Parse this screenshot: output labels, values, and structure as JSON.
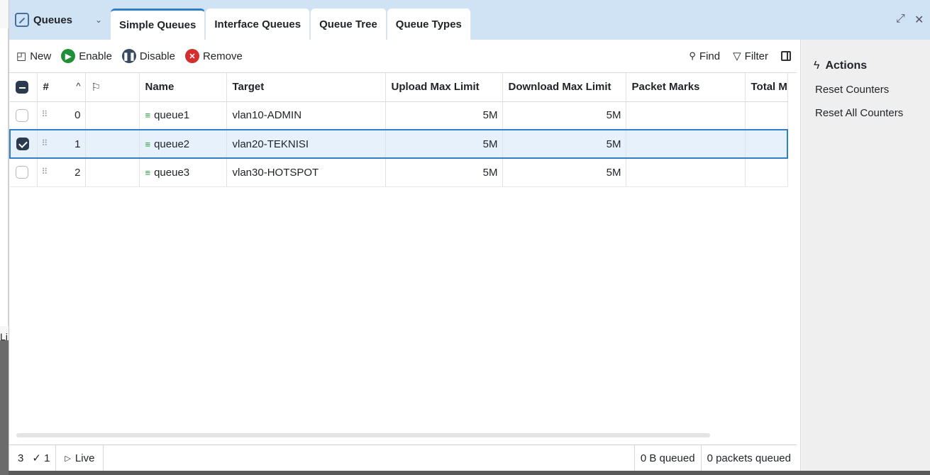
{
  "window": {
    "app_title": "Queues",
    "dropdown_glyph": "⌄",
    "tabs": [
      {
        "label": "Simple Queues",
        "active": true
      },
      {
        "label": "Interface Queues",
        "active": false
      },
      {
        "label": "Queue Tree",
        "active": false
      },
      {
        "label": "Queue Types",
        "active": false
      }
    ],
    "restore_glyph": "⤢",
    "close_glyph": "✕"
  },
  "toolbar": {
    "new_label": "New",
    "enable_label": "Enable",
    "disable_label": "Disable",
    "remove_label": "Remove",
    "find_label": "Find",
    "filter_label": "Filter"
  },
  "table": {
    "columns": [
      "",
      "#",
      "",
      "Name",
      "Target",
      "Upload Max Limit",
      "Download Max Limit",
      "Packet Marks",
      "Total M"
    ],
    "rows": [
      {
        "checked": false,
        "num": "0",
        "name": "queue1",
        "target": "vlan10-ADMIN",
        "upload": "5M",
        "download": "5M",
        "marks": "",
        "total": ""
      },
      {
        "checked": true,
        "num": "1",
        "name": "queue2",
        "target": "vlan20-TEKNISI",
        "upload": "5M",
        "download": "5M",
        "marks": "",
        "total": ""
      },
      {
        "checked": false,
        "num": "2",
        "name": "queue3",
        "target": "vlan30-HOTSPOT",
        "upload": "5M",
        "download": "5M",
        "marks": "",
        "total": ""
      }
    ]
  },
  "statusbar": {
    "count": "3",
    "selected": "✓ 1",
    "live": "Live",
    "bytes_queued": "0 B queued",
    "packets_queued": "0 packets queued"
  },
  "actions": {
    "title": "Actions",
    "items": [
      "Reset Counters",
      "Reset All Counters"
    ]
  },
  "background": {
    "left_fragment": "Li"
  },
  "colors": {
    "tabbar_bg": "#cfe3f4",
    "accent": "#2f80c9",
    "enable_green": "#1f8f3a",
    "remove_red": "#d32f2f"
  }
}
